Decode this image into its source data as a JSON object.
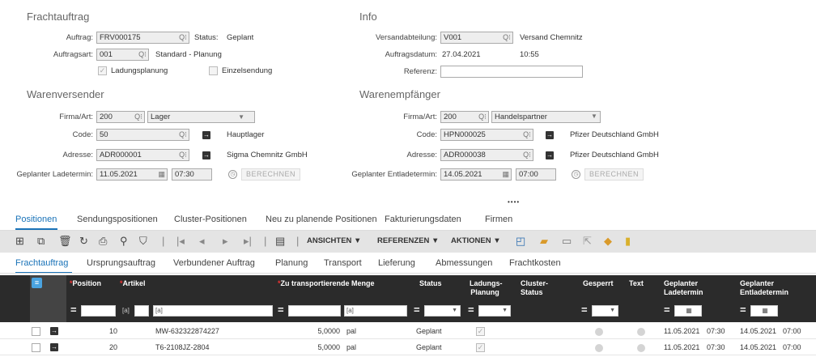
{
  "sections": {
    "frachtauftrag": "Frachtauftrag",
    "info": "Info",
    "warenversender": "Warenversender",
    "warenempfaenger": "Warenempfänger"
  },
  "frachtauftrag": {
    "auftrag_label": "Auftrag:",
    "auftrag_value": "FRV000175",
    "status_label": "Status:",
    "status_value": "Geplant",
    "auftragsart_label": "Auftragsart:",
    "auftragsart_value": "001",
    "auftragsart_text": "Standard - Planung",
    "ladungsplanung_label": "Ladungsplanung",
    "einzelsendung_label": "Einzelsendung"
  },
  "info": {
    "versandabteilung_label": "Versandabteilung:",
    "versandabteilung_value": "V001",
    "versandabteilung_text": "Versand Chemnitz",
    "auftragsdatum_label": "Auftragsdatum:",
    "auftragsdatum_date": "27.04.2021",
    "auftragsdatum_time": "10:55",
    "referenz_label": "Referenz:",
    "referenz_value": ""
  },
  "versender": {
    "firma_label": "Firma/Art:",
    "firma_value": "200",
    "firma_type": "Lager",
    "code_label": "Code:",
    "code_value": "50",
    "code_text": "Hauptlager",
    "adresse_label": "Adresse:",
    "adresse_value": "ADR000001",
    "adresse_text": "Sigma Chemnitz GmbH",
    "termin_label": "Geplanter Ladetermin:",
    "termin_date": "11.05.2021",
    "termin_time": "07:30",
    "calc_label": "BERECHNEN"
  },
  "empfaenger": {
    "firma_label": "Firma/Art:",
    "firma_value": "200",
    "firma_type": "Handelspartner",
    "code_label": "Code:",
    "code_value": "HPN000025",
    "code_text": "Pfizer Deutschland GmbH",
    "adresse_label": "Adresse:",
    "adresse_value": "ADR000038",
    "adresse_text": "Pfizer Deutschland GmbH",
    "termin_label": "Geplanter Entladetermin:",
    "termin_date": "14.05.2021",
    "termin_time": "07:00",
    "calc_label": "BERECHNEN"
  },
  "more_indicator": "••••",
  "main_tabs": [
    "Positionen",
    "Sendungspositionen",
    "Cluster-Positionen",
    "Neu zu planende Positionen",
    "Fakturierungsdaten",
    "Firmen"
  ],
  "toolbar": {
    "ansichten": "ANSICHTEN ▼",
    "referenzen": "REFERENZEN ▼",
    "aktionen": "AKTIONEN ▼"
  },
  "sub_tabs": [
    "Frachtauftrag",
    "Ursprungsauftrag",
    "Verbundener Auftrag",
    "Planung",
    "Transport",
    "Lieferung",
    "Abmessungen",
    "Frachtkosten"
  ],
  "table": {
    "columns": {
      "position": "Position",
      "artikel": "Artikel",
      "menge": "Zu transportierende Menge",
      "status": "Status",
      "ladungs1": "Ladungs-",
      "ladungs2": "Planung",
      "cluster1": "Cluster-",
      "cluster2": "Status",
      "gesperrt": "Gesperrt",
      "text": "Text",
      "lade1": "Geplanter",
      "lade2": "Ladetermin",
      "entlade1": "Geplanter",
      "entlade2": "Entladetermin"
    },
    "filter_tag": "[a]",
    "rows": [
      {
        "position": "10",
        "artikel": "MW-632322874227",
        "menge": "5,0000",
        "einheit": "pal",
        "status": "Geplant",
        "lade_date": "11.05.2021",
        "lade_time": "07:30",
        "entlade_date": "14.05.2021",
        "entlade_time": "07:00"
      },
      {
        "position": "20",
        "artikel": "T6-2108JZ-2804",
        "menge": "5,0000",
        "einheit": "pal",
        "status": "Geplant",
        "lade_date": "11.05.2021",
        "lade_time": "07:30",
        "entlade_date": "14.05.2021",
        "entlade_time": "07:00"
      }
    ]
  },
  "colors": {
    "accent": "#1a73b8",
    "header": "#2b2b2b",
    "required": "#e33333"
  }
}
